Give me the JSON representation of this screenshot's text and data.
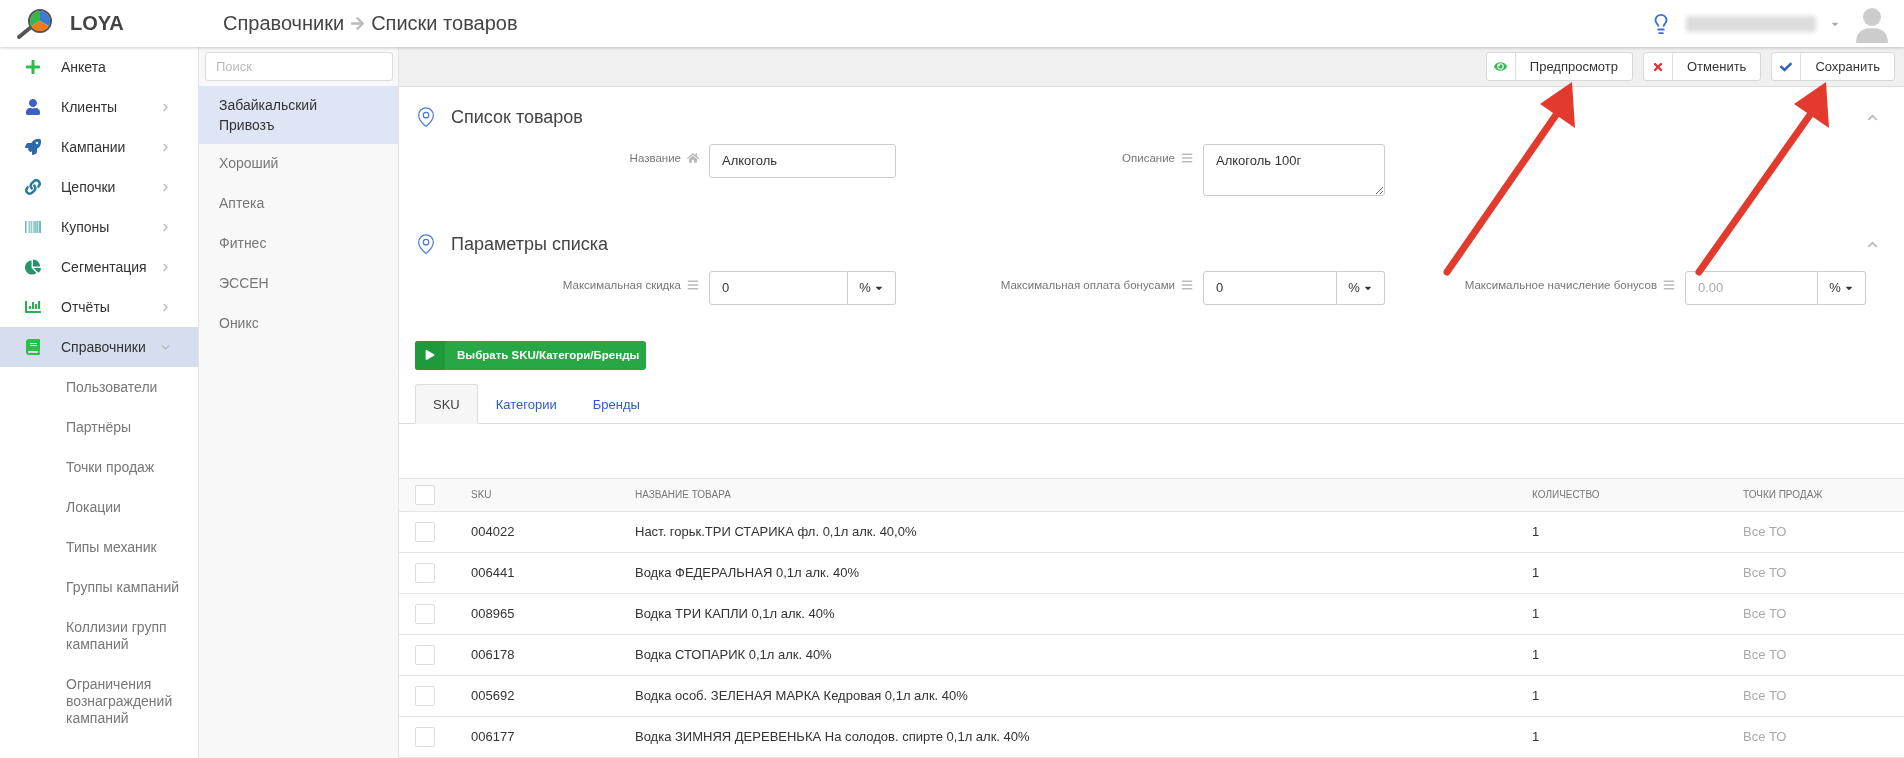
{
  "app": {
    "logo": "LOYA"
  },
  "breadcrumb": [
    {
      "label": "Справочники"
    },
    {
      "label": "Списки товаров"
    }
  ],
  "sidebar": {
    "items": [
      {
        "label": "Анкета",
        "selected": false
      },
      {
        "label": "Клиенты",
        "selected": false,
        "expanded": false
      },
      {
        "label": "Кампании",
        "selected": false,
        "expanded": false
      },
      {
        "label": "Цепочки",
        "selected": false,
        "expanded": false
      },
      {
        "label": "Купоны",
        "selected": false,
        "expanded": false
      },
      {
        "label": "Сегментация",
        "selected": false,
        "expanded": false
      },
      {
        "label": "Отчёты",
        "selected": false,
        "expanded": false
      },
      {
        "label": "Справочники",
        "selected": true,
        "expanded": true,
        "children": [
          {
            "label": "Пользователи"
          },
          {
            "label": "Партнёры"
          },
          {
            "label": "Точки продаж"
          },
          {
            "label": "Локации"
          },
          {
            "label": "Типы механик"
          },
          {
            "label": "Группы кампаний"
          },
          {
            "label": "Коллизии групп кампаний"
          },
          {
            "label": "Ограничения вознаграждений кампаний"
          }
        ]
      }
    ]
  },
  "lists": {
    "search": {
      "placeholder": "Поиск"
    },
    "items": [
      {
        "label": "Забайкальский Привозъ",
        "selected": true
      },
      {
        "label": "Хороший",
        "selected": false
      },
      {
        "label": "Аптека",
        "selected": false
      },
      {
        "label": "Фитнес",
        "selected": false
      },
      {
        "label": "ЭССЕН",
        "selected": false
      },
      {
        "label": "Оникс",
        "selected": false
      }
    ]
  },
  "toolbar": {
    "buttons": [
      {
        "label": "Предпросмотр"
      },
      {
        "label": "Отменить"
      },
      {
        "label": "Сохранить"
      }
    ]
  },
  "sections": [
    {
      "title": "Список товаров",
      "expanded": true,
      "fields": [
        {
          "kind": "text",
          "label": "Название",
          "value": "Алкоголь"
        },
        {
          "kind": "textarea",
          "label": "Описание",
          "value": "Алкоголь 100г"
        }
      ]
    },
    {
      "title": "Параметры списка",
      "expanded": true,
      "fields": [
        {
          "kind": "percent",
          "label": "Максимальная скидка",
          "value": "0",
          "unit": "%"
        },
        {
          "kind": "percent",
          "label": "Максимальная оплата бонусами",
          "value": "0",
          "unit": "%"
        },
        {
          "kind": "percent",
          "label": "Максимальное начисление бонусов",
          "placeholder": "0.00",
          "unit": "%"
        }
      ]
    }
  ],
  "select_button": {
    "label": "Выбрать SKU/Категори/Бренды"
  },
  "tabs": [
    {
      "label": "SKU",
      "selected": true
    },
    {
      "label": "Категории",
      "selected": false
    },
    {
      "label": "Бренды",
      "selected": false
    }
  ],
  "table": {
    "columns": [
      "SKU",
      "НАЗВАНИЕ ТОВАРА",
      "КОЛИЧЕСТВО",
      "ТОЧКИ ПРОДАЖ"
    ],
    "all_checked": false,
    "rows": [
      {
        "checked": false,
        "cells": [
          "004022",
          "Наст. горьк.ТРИ СТАРИКА фл. 0,1л алк. 40,0%",
          "1",
          "Все ТО"
        ]
      },
      {
        "checked": false,
        "cells": [
          "006441",
          "Водка ФЕДЕРАЛЬНАЯ 0,1л алк. 40%",
          "1",
          "Все ТО"
        ]
      },
      {
        "checked": false,
        "cells": [
          "008965",
          "Водка ТРИ КАПЛИ 0,1л алк. 40%",
          "1",
          "Все ТО"
        ]
      },
      {
        "checked": false,
        "cells": [
          "006178",
          "Водка СТОПАРИК 0,1л алк. 40%",
          "1",
          "Все ТО"
        ]
      },
      {
        "checked": false,
        "cells": [
          "005692",
          "Водка особ. ЗЕЛЕНАЯ МАРКА Кедровая 0,1л алк. 40%",
          "1",
          "Все ТО"
        ]
      },
      {
        "checked": false,
        "cells": [
          "006177",
          "Водка ЗИМНЯЯ ДЕРЕВЕНЬКА На солодов. спирте 0,1л алк. 40%",
          "1",
          "Все ТО"
        ]
      }
    ]
  }
}
